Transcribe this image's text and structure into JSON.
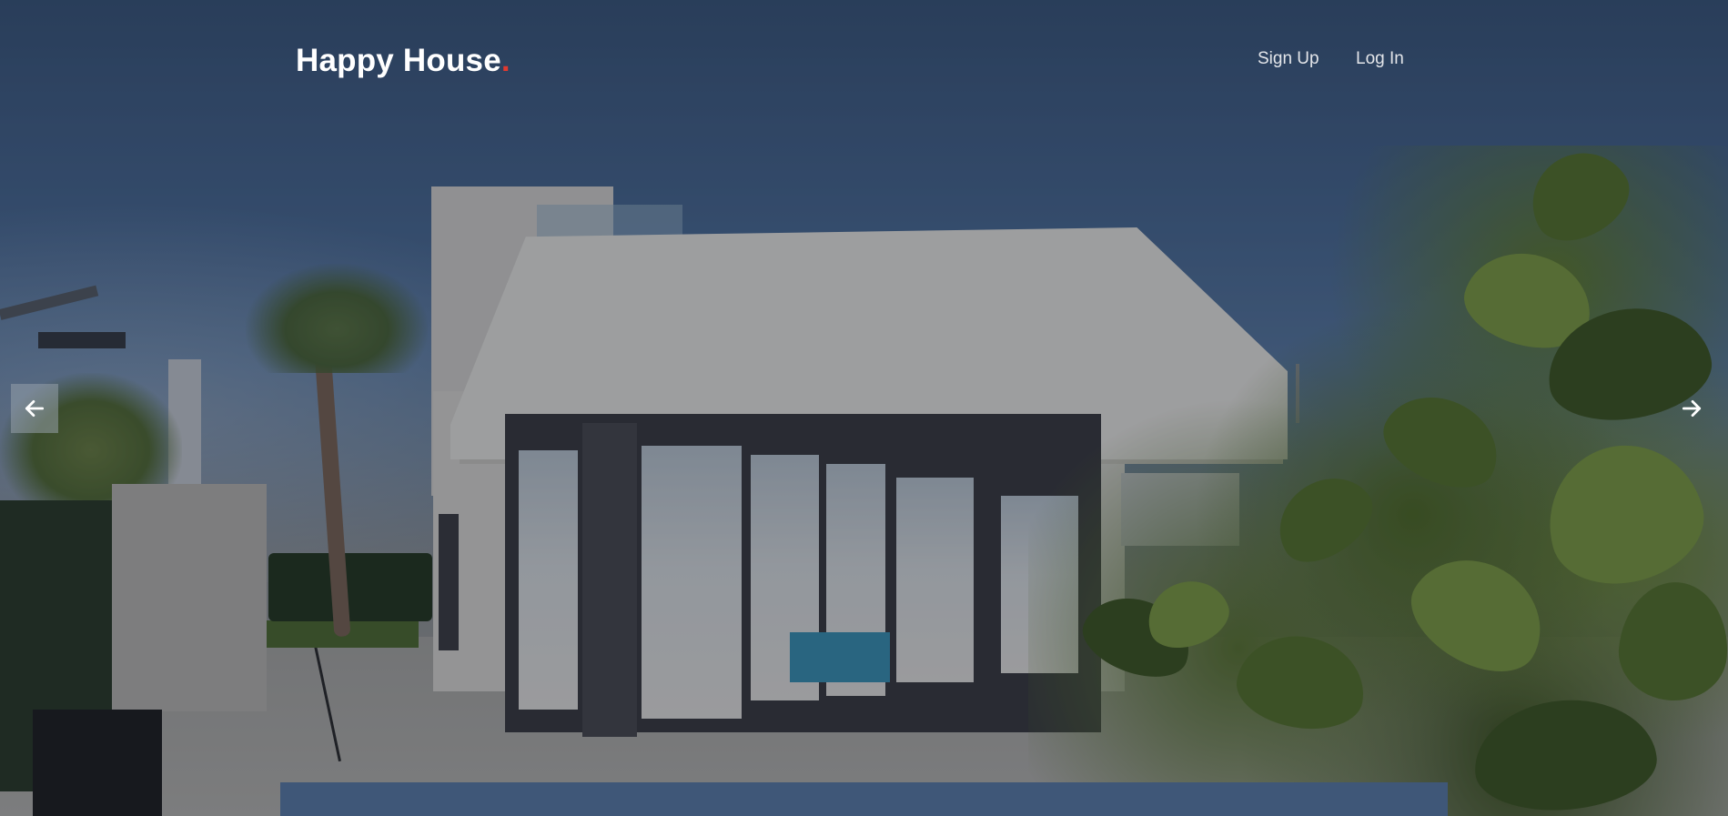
{
  "brand": {
    "name": "Happy House",
    "dot": ".",
    "dot_color": "#e03a2f"
  },
  "nav": {
    "signup_label": "Sign Up",
    "login_label": "Log In"
  },
  "carousel": {
    "prev_icon": "arrow-left-icon",
    "next_icon": "arrow-right-icon"
  },
  "hero_image": {
    "subject": "modern-house-photo"
  },
  "colors": {
    "panel": "#3f5778",
    "text": "#ffffff"
  }
}
